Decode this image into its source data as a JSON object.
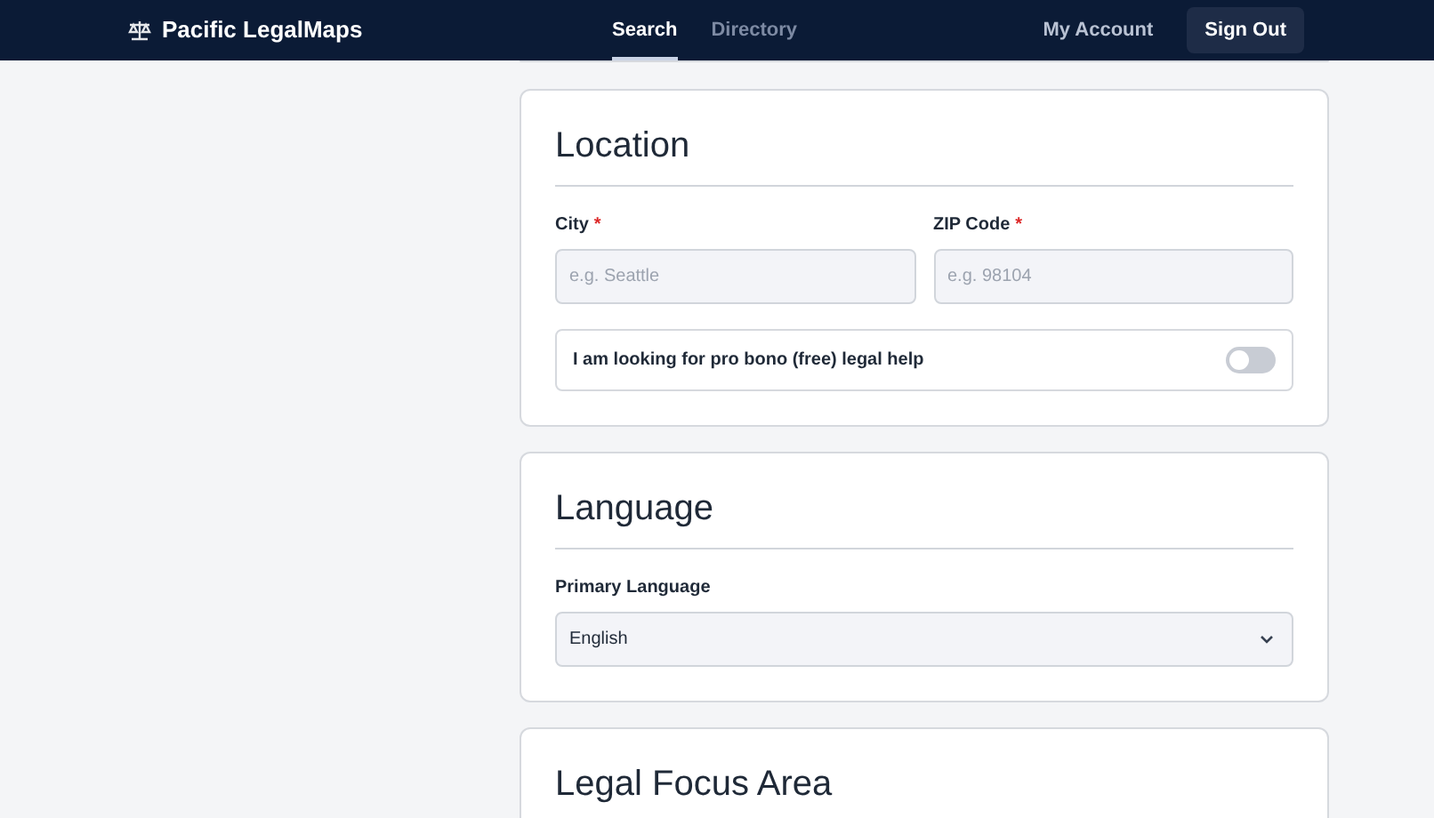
{
  "header": {
    "brand": "Pacific LegalMaps",
    "nav": [
      {
        "label": "Search",
        "selected": true
      },
      {
        "label": "Directory",
        "selected": false
      }
    ],
    "account_link": "My Account",
    "sign_out": "Sign Out"
  },
  "sections": [
    {
      "title": "Location",
      "fields": [
        {
          "kind": "text_pair",
          "items": [
            {
              "label": "City",
              "required_mark": "*",
              "placeholder": "e.g. Seattle"
            },
            {
              "label": "ZIP Code",
              "required_mark": "*",
              "placeholder": "e.g. 98104"
            }
          ]
        },
        {
          "kind": "toggle",
          "label": "I am looking for pro bono (free) legal help",
          "on": false
        }
      ]
    },
    {
      "title": "Language",
      "fields": [
        {
          "kind": "select",
          "label": "Primary Language",
          "value": "English"
        }
      ]
    },
    {
      "title": "Legal Focus Area"
    }
  ]
}
